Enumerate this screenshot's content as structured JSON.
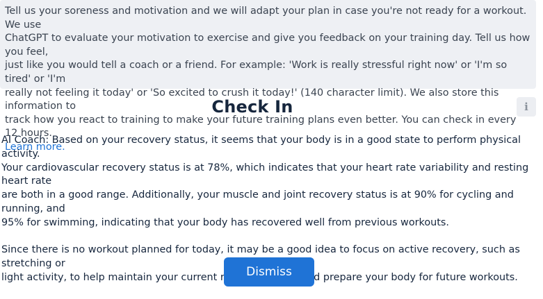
{
  "notice": {
    "lines": [
      "Tell us your soreness and motivation and we will adapt your plan in case you're not ready for a workout. We use",
      "ChatGPT to evaluate your motivation to exercise and give you feedback on your training day. Tell us how you feel,",
      "just like you would tell a coach or a friend. For example: 'Work is really stressful right now' or 'I'm so tired' or 'I'm",
      "really not feeling it today' or 'So excited to crush it today!' (140 character limit). We also store this information to",
      "track how you react to training to make your future training plans even better. You can check in every 12 hours."
    ],
    "learn_more": "Learn more."
  },
  "title": "Check In",
  "info_icon_glyph": "i",
  "coach": {
    "paragraph1_lines": [
      "AI Coach: Based on your recovery status, it seems that your body is in a good state to perform physical activity.",
      "Your cardiovascular recovery status is at 78%, which indicates that your heart rate variability and resting heart rate",
      "are both in a good range. Additionally, your muscle and joint recovery status is at 90% for cycling and running, and",
      "95% for swimming, indicating that your body has recovered well from previous workouts."
    ],
    "paragraph2_lines": [
      "Since there is no workout planned for today, it may be a good idea to focus on active recovery, such as stretching or",
      "light activity, to help maintain your current recovery status and prepare your body for future workouts."
    ]
  },
  "dismiss_label": "Dismiss",
  "colors": {
    "accent": "#1f73d6",
    "notice_bg": "#eef0f4",
    "title": "#16263d"
  }
}
